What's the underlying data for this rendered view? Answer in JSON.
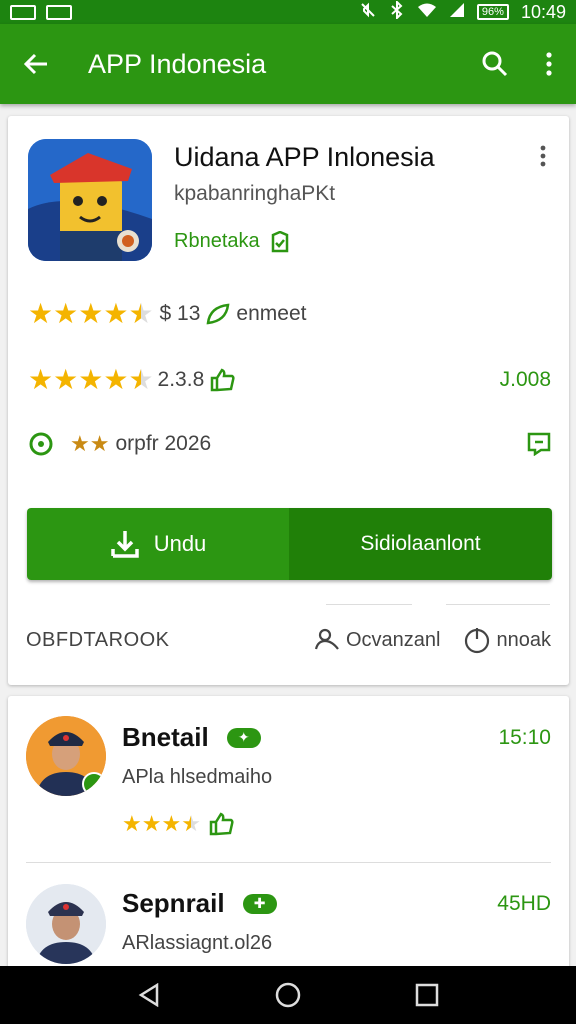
{
  "status_bar": {
    "time": "10:49",
    "battery": "96%"
  },
  "app_bar": {
    "title": "APP Indonesia"
  },
  "app": {
    "name": "Uidana APP Inlonesia",
    "developer": "kpabanringhaPKt",
    "category": "Rbnetaka",
    "rating_row_1": {
      "stars": 4.5,
      "text": "$ 13",
      "extra": "enmeet"
    },
    "rating_row_2": {
      "stars": 4.5,
      "text": "2.3.8",
      "right": "J.008"
    },
    "info_row": {
      "stars": 2,
      "text": "orpfr 2026"
    },
    "install_label": "Undu",
    "open_label": "Sidiolaanlont",
    "footer_label": "OBFDTAROOK",
    "footer_action_1": "Ocvanzanl",
    "footer_action_2": "nnoak"
  },
  "reviews": [
    {
      "name": "Bnetail",
      "time": "15:10",
      "text": "APla hlsedmaiho",
      "stars": 3.5
    },
    {
      "name": "Sepnrail",
      "time": "45HD",
      "text": "ARlassiagnt.ol26"
    }
  ],
  "colors": {
    "primary": "#2c9612",
    "primary_dark": "#1d8410",
    "star": "#f4b400"
  }
}
